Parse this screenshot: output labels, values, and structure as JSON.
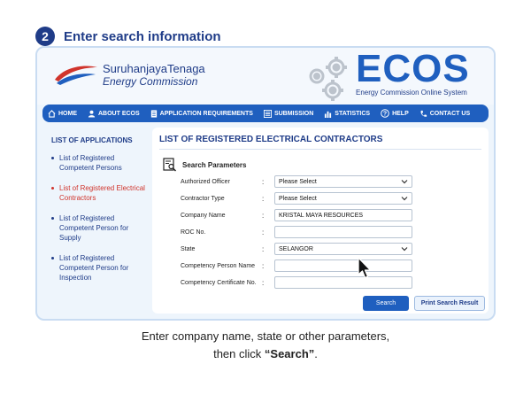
{
  "step": {
    "number": "2",
    "title": "Enter search information"
  },
  "header": {
    "logo_line1": "SuruhanjayaTenaga",
    "logo_line2": "Energy Commission",
    "ecos_word": "ECOS",
    "ecos_sub": "Energy Commission Online System"
  },
  "nav": {
    "items": [
      {
        "label": "HOME",
        "icon": "home-icon"
      },
      {
        "label": "ABOUT ECOS",
        "icon": "user-icon"
      },
      {
        "label": "APPLICATION REQUIREMENTS",
        "icon": "document-icon"
      },
      {
        "label": "SUBMISSION",
        "icon": "list-icon"
      },
      {
        "label": "STATISTICS",
        "icon": "bar-chart-icon"
      },
      {
        "label": "HELP",
        "icon": "help-icon"
      },
      {
        "label": "CONTACT US",
        "icon": "phone-icon"
      }
    ]
  },
  "sidebar": {
    "title": "LIST OF APPLICATIONS",
    "items": [
      {
        "label": "List of Registered Competent Persons",
        "active": false
      },
      {
        "label": "List of Registered Electrical Contractors",
        "active": true
      },
      {
        "label": "List of Registered Competent Person for Supply",
        "active": false
      },
      {
        "label": "List of Registered Competent Person for Inspection",
        "active": false
      }
    ]
  },
  "panel": {
    "title": "LIST OF REGISTERED ELECTRICAL CONTRACTORS",
    "search_heading": "Search Parameters",
    "fields": [
      {
        "label": "Authorized Officer",
        "value": "Please Select",
        "type": "select"
      },
      {
        "label": "Contractor Type",
        "value": "Please Select",
        "type": "select"
      },
      {
        "label": "Company Name",
        "value": "KRISTAL MAYA RESOURCES",
        "type": "text"
      },
      {
        "label": "ROC No.",
        "value": "",
        "type": "text"
      },
      {
        "label": "State",
        "value": "SELANGOR",
        "type": "select"
      },
      {
        "label": "Competency Person Name",
        "value": "",
        "type": "text"
      },
      {
        "label": "Competency Certificate No.",
        "value": "",
        "type": "text"
      }
    ],
    "colon": ":",
    "search_button": "Search",
    "print_button": "Print Search Result"
  },
  "caption": {
    "line1": "Enter company name, state or other parameters,",
    "line2_prefix": "then click ",
    "line2_bold": "“Search”",
    "line2_suffix": "."
  },
  "colors": {
    "primary": "#1f5fbf",
    "dark_blue": "#1f3c88",
    "active_red": "#d0342c"
  }
}
